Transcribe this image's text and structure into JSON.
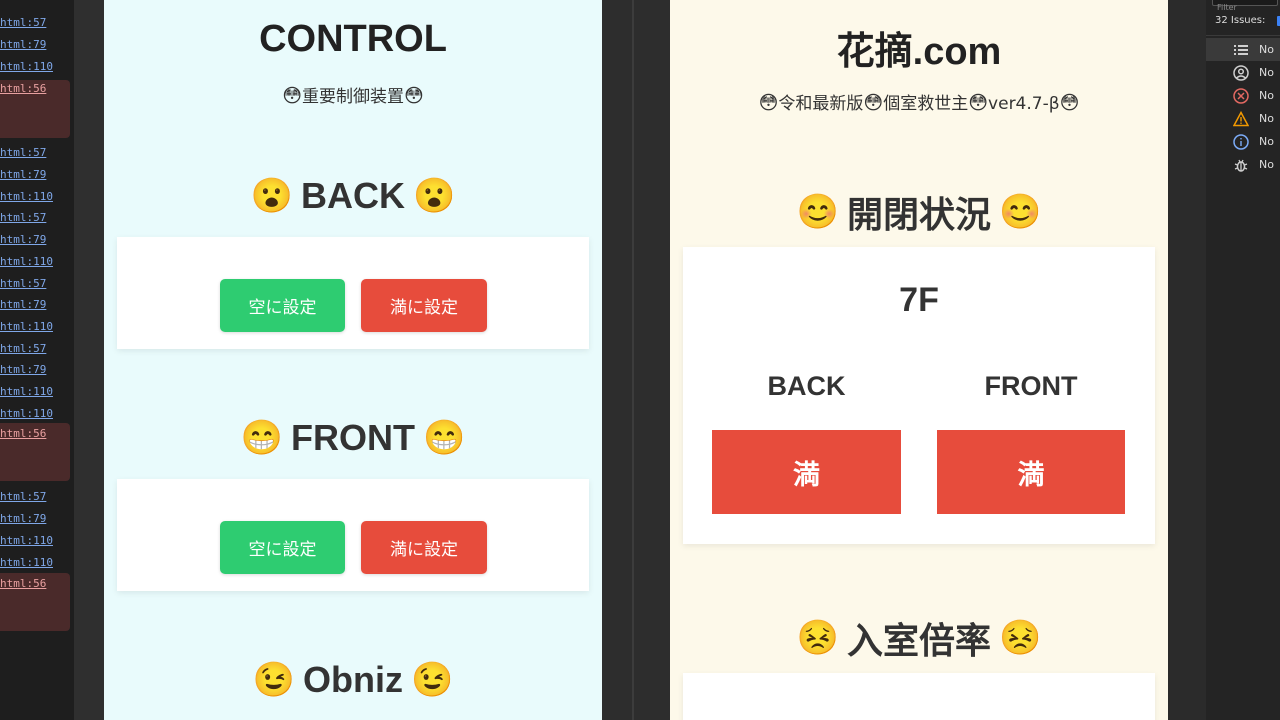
{
  "console": {
    "rows": [
      {
        "text": "html:57",
        "err": false
      },
      {
        "text": "html:79",
        "err": false
      },
      {
        "text": "html:110",
        "err": false
      },
      {
        "text": "html:56",
        "err": true
      },
      {
        "text": "html:57",
        "err": false
      },
      {
        "text": "html:79",
        "err": false
      },
      {
        "text": "html:110",
        "err": false
      },
      {
        "text": "html:57",
        "err": false
      },
      {
        "text": "html:79",
        "err": false
      },
      {
        "text": "html:110",
        "err": false
      },
      {
        "text": "html:57",
        "err": false
      },
      {
        "text": "html:79",
        "err": false
      },
      {
        "text": "html:110",
        "err": false
      },
      {
        "text": "html:57",
        "err": false
      },
      {
        "text": "html:79",
        "err": false
      },
      {
        "text": "html:110",
        "err": false
      },
      {
        "text": "html:110",
        "err": false
      },
      {
        "text": "html:56",
        "err": true
      },
      {
        "text": "html:57",
        "err": false
      },
      {
        "text": "html:79",
        "err": false
      },
      {
        "text": "html:110",
        "err": false
      },
      {
        "text": "html:110",
        "err": false
      },
      {
        "text": "html:56",
        "err": true
      }
    ]
  },
  "control": {
    "title": "CONTROL",
    "subtitle_emoji": "😳",
    "subtitle": "重要制御装置",
    "back": {
      "emoji": "😮",
      "heading": "BACK",
      "empty_label": "空に設定",
      "full_label": "満に設定"
    },
    "front": {
      "emoji": "😁",
      "heading": "FRONT",
      "empty_label": "空に設定",
      "full_label": "満に設定"
    },
    "obniz": {
      "emoji": "😉",
      "heading": "Obniz"
    }
  },
  "status": {
    "title": "花摘.com",
    "subtitle_emoji": "😳",
    "subtitle_parts": [
      "令和最新版",
      "個室救世主",
      "ver4.7-β"
    ],
    "open_status": {
      "emoji": "😊",
      "heading": "開閉状況",
      "floor": "7F",
      "back_label": "BACK",
      "front_label": "FRONT",
      "back_state": "満",
      "front_state": "満",
      "state_color": "#e74c3c"
    },
    "occupancy": {
      "emoji": "😣",
      "heading": "入室倍率"
    }
  },
  "devtools": {
    "filter_placeholder": "Filter",
    "issues_label": "32 Issues:",
    "items": [
      {
        "icon": "list-icon",
        "text": "No"
      },
      {
        "icon": "user-circle-icon",
        "text": "No"
      },
      {
        "icon": "error-circle-icon",
        "text": "No"
      },
      {
        "icon": "warning-triangle-icon",
        "text": "No"
      },
      {
        "icon": "info-circle-icon",
        "text": "No"
      },
      {
        "icon": "bug-icon",
        "text": "No"
      }
    ]
  },
  "colors": {
    "green": "#2ecc71",
    "red": "#e74c3c",
    "control_bg": "#e9fbfc",
    "status_bg": "#fdf9ea"
  }
}
